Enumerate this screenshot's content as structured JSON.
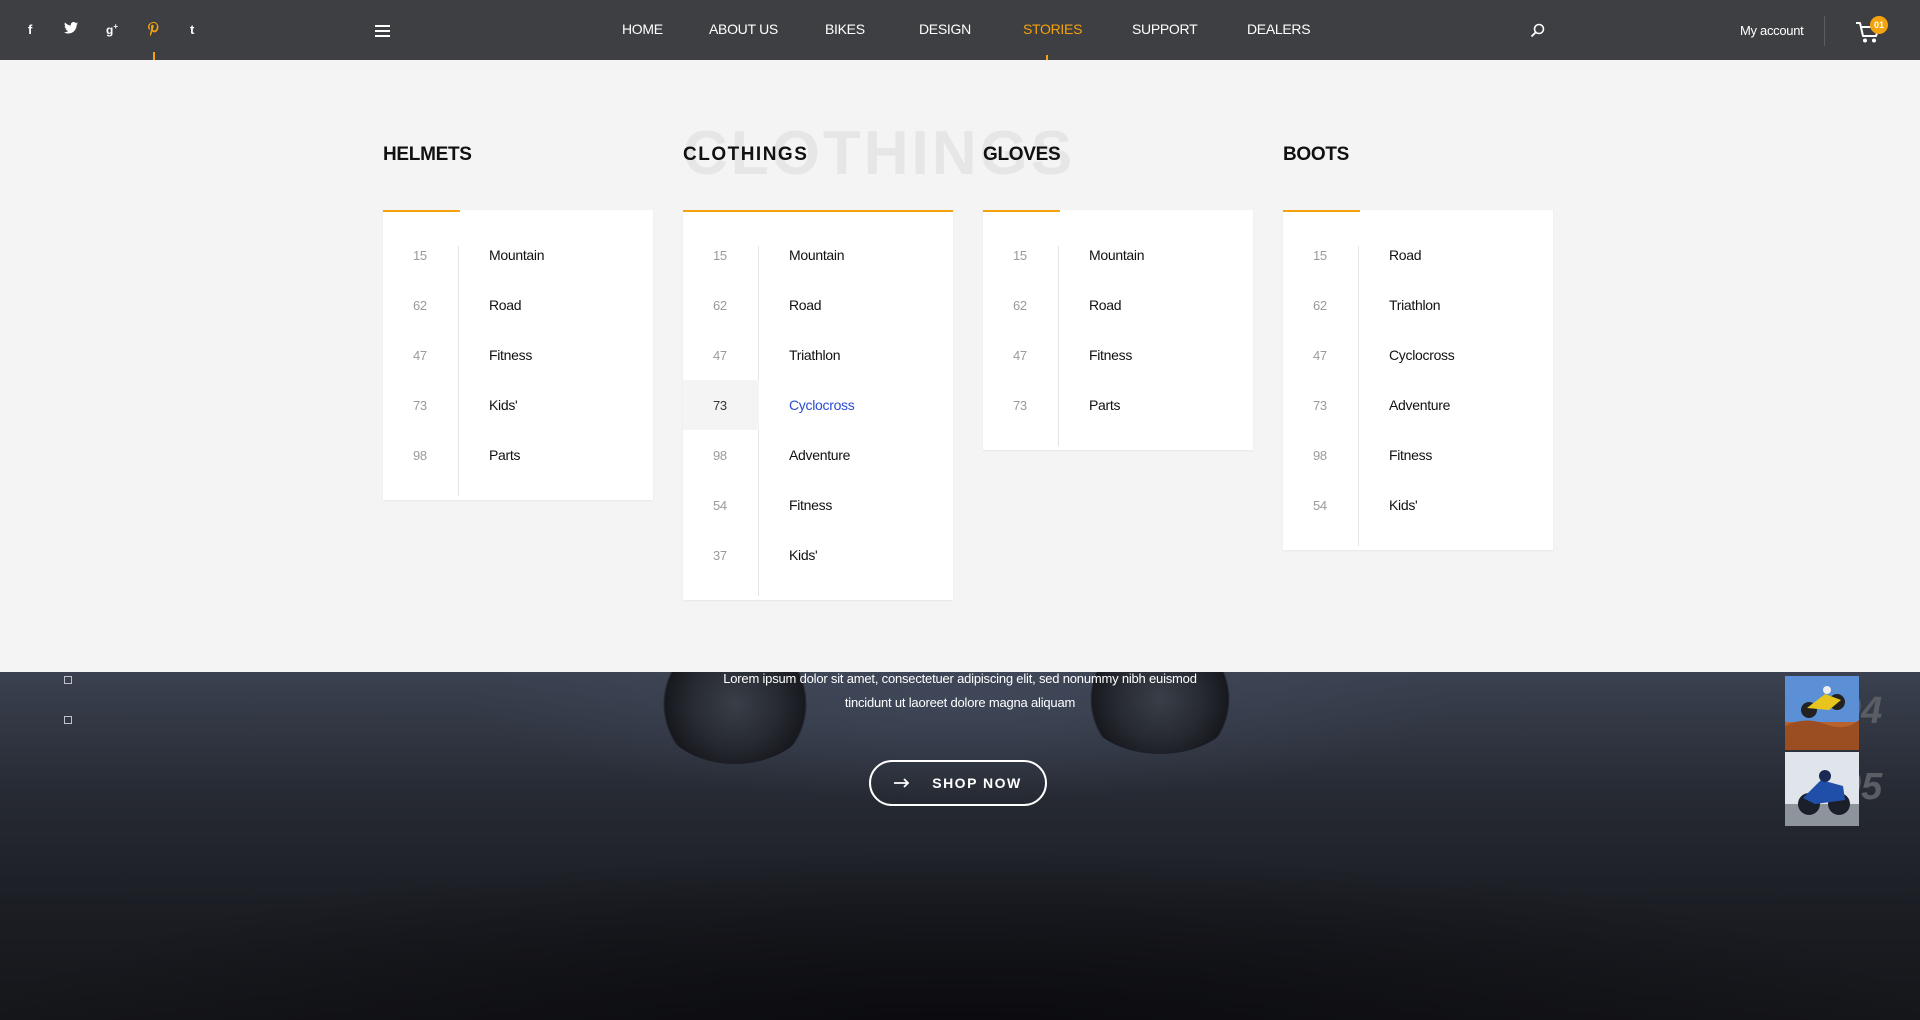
{
  "social": [
    {
      "icon": "facebook-icon",
      "glyph": "f"
    },
    {
      "icon": "twitter-icon",
      "glyph": "t"
    },
    {
      "icon": "google-plus-icon",
      "glyph": "g+"
    },
    {
      "icon": "pinterest-icon",
      "glyph": "p",
      "active": true
    },
    {
      "icon": "tumblr-icon",
      "glyph": "t"
    }
  ],
  "nav": {
    "items": [
      {
        "label": "HOME"
      },
      {
        "label": "ABOUT US"
      },
      {
        "label": "BIKES"
      },
      {
        "label": "DESIGN"
      },
      {
        "label": "STORIES",
        "active": true
      },
      {
        "label": "SUPPORT"
      },
      {
        "label": "DEALERS"
      }
    ],
    "account_label": "My account",
    "cart_count": "01"
  },
  "menu": {
    "watermark": "CLOTHINGS",
    "columns": [
      {
        "title": "HELMETS",
        "items": [
          {
            "num": "15",
            "label": "Mountain"
          },
          {
            "num": "62",
            "label": "Road"
          },
          {
            "num": "47",
            "label": "Fitness"
          },
          {
            "num": "73",
            "label": "Kids'"
          },
          {
            "num": "98",
            "label": "Parts"
          }
        ]
      },
      {
        "title": "CLOTHINGS",
        "items": [
          {
            "num": "15",
            "label": "Mountain"
          },
          {
            "num": "62",
            "label": "Road"
          },
          {
            "num": "47",
            "label": "Triathlon"
          },
          {
            "num": "73",
            "label": "Cyclocross",
            "highlighted": true
          },
          {
            "num": "98",
            "label": "Adventure"
          },
          {
            "num": "54",
            "label": "Fitness"
          },
          {
            "num": "37",
            "label": "Kids'"
          }
        ]
      },
      {
        "title": "GLOVES",
        "items": [
          {
            "num": "15",
            "label": "Mountain"
          },
          {
            "num": "62",
            "label": "Road"
          },
          {
            "num": "47",
            "label": "Fitness"
          },
          {
            "num": "73",
            "label": "Parts"
          }
        ]
      },
      {
        "title": "BOOTS",
        "items": [
          {
            "num": "15",
            "label": "Road"
          },
          {
            "num": "62",
            "label": "Triathlon"
          },
          {
            "num": "47",
            "label": "Cyclocross"
          },
          {
            "num": "73",
            "label": "Adventure"
          },
          {
            "num": "98",
            "label": "Fitness"
          },
          {
            "num": "54",
            "label": "Kids'"
          }
        ]
      }
    ]
  },
  "hero": {
    "line1": "Lorem ipsum dolor sit amet, consectetuer adipiscing elit, sed nonummy nibh euismod",
    "line2": "tincidunt ut laoreet dolore magna aliquam",
    "button_label": "SHOP NOW",
    "slides": [
      "04",
      "05"
    ]
  },
  "colors": {
    "accent": "#f4a20d",
    "highlight_link": "#2b4bd1",
    "topbar": "#3e3f42"
  }
}
